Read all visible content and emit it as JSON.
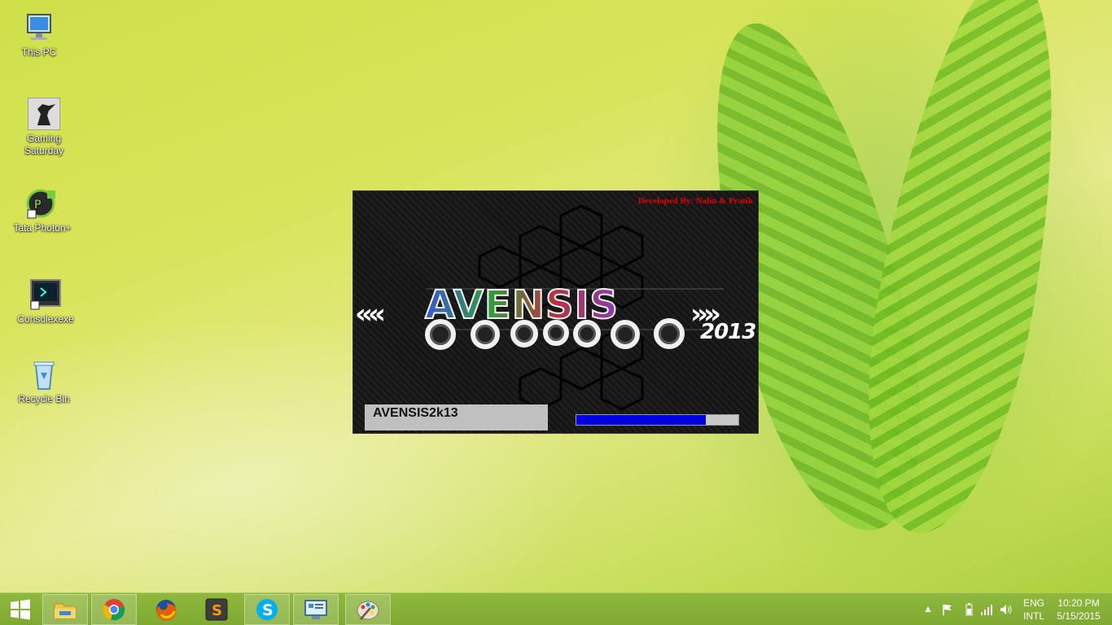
{
  "desktop": {
    "icons": [
      {
        "label": "This PC"
      },
      {
        "label": "Gaming Saturday"
      },
      {
        "label": "Tata Photon+"
      },
      {
        "label": "Consolexexe"
      },
      {
        "label": "Recycle Bin"
      }
    ]
  },
  "splash": {
    "credit": "Developed By: Nalin & Pratik",
    "logo": "AVENSIS",
    "year": "2013",
    "status": "AVENSIS2k13",
    "progress": 0.8
  },
  "taskbar": {
    "apps": [
      "start-icon",
      "file-explorer-icon",
      "chrome-icon",
      "firefox-icon",
      "sublime-text-icon",
      "skype-icon",
      "control-panel-icon",
      "paint-icon"
    ],
    "tray": {
      "lang_top": "ENG",
      "lang_bottom": "INTL",
      "time": "10:20 PM",
      "date": "5/15/2015"
    }
  },
  "colors": {
    "progress_fill": "#0000e0",
    "credit_text": "#e00000"
  }
}
